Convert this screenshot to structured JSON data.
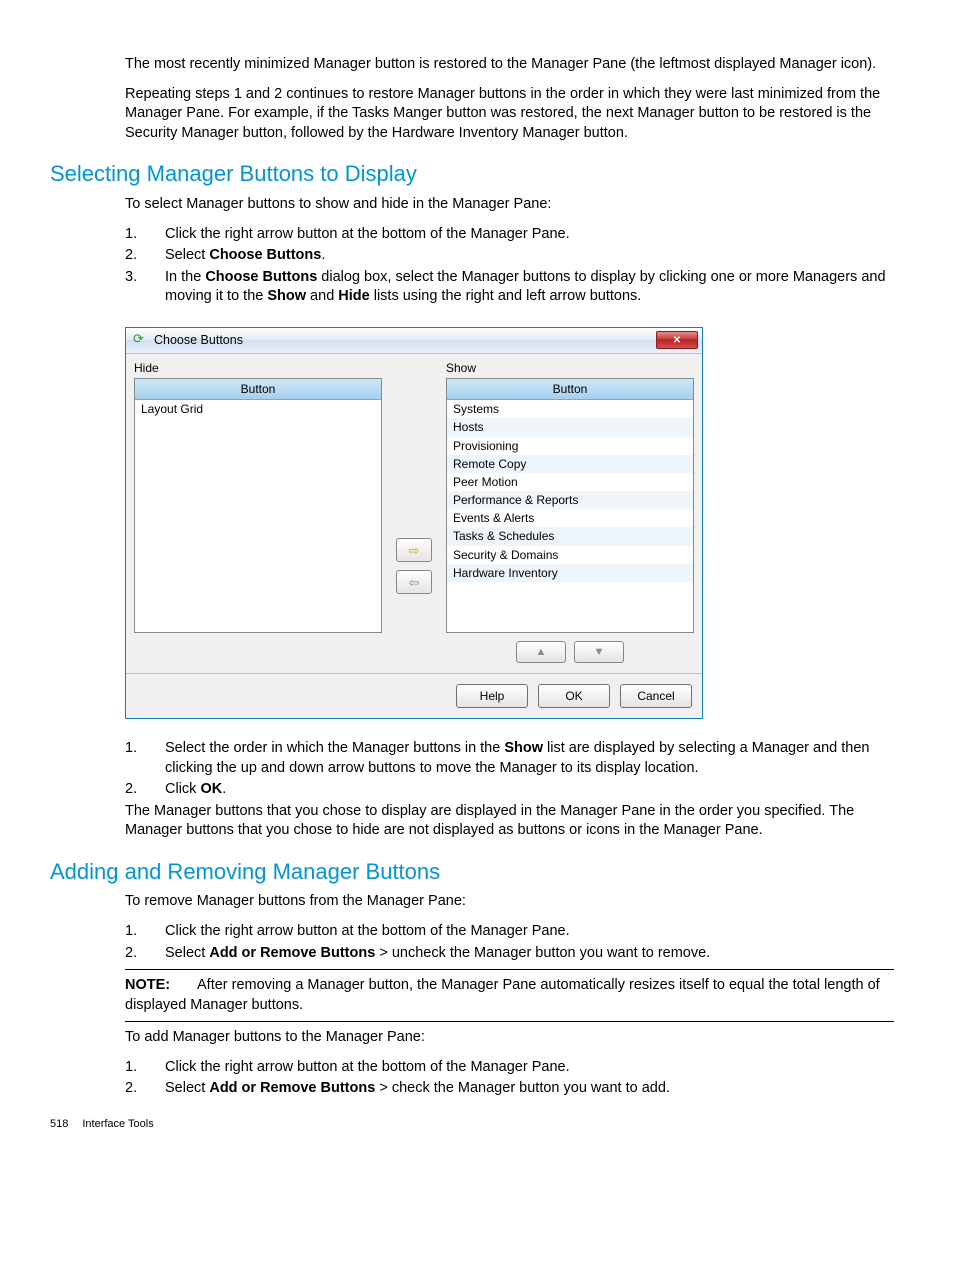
{
  "para1": "The most recently minimized Manager button is restored to the Manager Pane (the leftmost displayed Manager icon).",
  "para2": "Repeating steps 1 and 2 continues to restore Manager buttons in the order in which they were last minimized from the Manager Pane. For example, if the Tasks Manger button was restored, the next Manager button to be restored is the Security Manager button, followed by the Hardware Inventory Manager button.",
  "h1": "Selecting Manager Buttons to Display",
  "s1_intro": "To select Manager buttons to show and hide in the Manager Pane:",
  "s1_steps": {
    "a": "Click the right arrow button at the bottom of the Manager Pane.",
    "b_pre": "Select ",
    "b_bold": "Choose Buttons",
    "b_post": ".",
    "c_pre": "In the ",
    "c_b1": "Choose Buttons",
    "c_mid": " dialog box, select the Manager buttons to display by clicking one or more Managers and moving it to the ",
    "c_b2": "Show",
    "c_mid2": " and ",
    "c_b3": "Hide",
    "c_post": " lists using the right and left arrow buttons."
  },
  "dialog": {
    "title": "Choose Buttons",
    "hide_label": "Hide",
    "show_label": "Show",
    "col_header": "Button",
    "hide_items": [
      "Layout Grid"
    ],
    "show_items": [
      "Systems",
      "Hosts",
      "Provisioning",
      "Remote Copy",
      "Peer Motion",
      "Performance & Reports",
      "Events & Alerts",
      "Tasks & Schedules",
      "Security & Domains",
      "Hardware Inventory"
    ],
    "help": "Help",
    "ok": "OK",
    "cancel": "Cancel"
  },
  "s1b_steps": {
    "a_pre": "Select the order in which the Manager buttons in the ",
    "a_b": "Show",
    "a_post": " list are displayed by selecting a Manager and then clicking the up and down arrow buttons to move the Manager to its display location.",
    "b_pre": "Click ",
    "b_b": "OK",
    "b_post": "."
  },
  "s1_out": "The Manager buttons that you chose to display are displayed in the Manager Pane in the order you specified. The Manager buttons that you chose to hide are not displayed as buttons or icons in the Manager Pane.",
  "h2": "Adding and Removing Manager Buttons",
  "s2_intro": "To remove Manager buttons from the Manager Pane:",
  "s2_steps": {
    "a": "Click the right arrow button at the bottom of the Manager Pane.",
    "b_pre": "Select ",
    "b_b": "Add or Remove Buttons",
    "b_post": " > uncheck the Manager button you want to remove."
  },
  "note_label": "NOTE:",
  "note_text": "After removing a Manager button, the Manager Pane automatically resizes itself to equal the total length of displayed Manager buttons.",
  "s3_intro": "To add Manager buttons to the Manager Pane:",
  "s3_steps": {
    "a": "Click the right arrow button at the bottom of the Manager Pane.",
    "b_pre": "Select ",
    "b_b": "Add or Remove Buttons",
    "b_post": " > check the Manager button you want to add."
  },
  "page_num": "518",
  "page_section": "Interface Tools"
}
